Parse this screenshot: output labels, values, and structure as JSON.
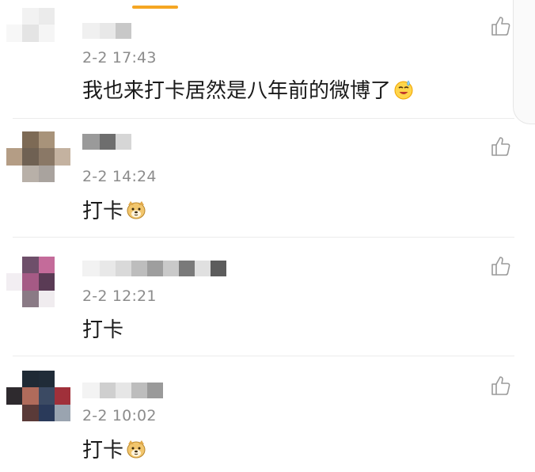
{
  "comments": [
    {
      "timestamp": "2-2 17:43",
      "text": "我也来打卡居然是八年前的微博了",
      "emoji": "sweat-smile-emoji",
      "avatar_colors": [
        "#ffffff",
        "#f2f2f2",
        "#ebebeb",
        "#ffffff",
        "#f7f7f7",
        "#e4e4e4",
        "#f5f5f5",
        "#ffffff",
        "#ffffff",
        "#ffffff",
        "#ffffff",
        "#ffffff"
      ],
      "name_blocks": [
        "#f0f0f0",
        "#e8e8e8",
        "#c8c8c8"
      ]
    },
    {
      "timestamp": "2-2 14:24",
      "text": "打卡",
      "emoji": "doge-emoji",
      "avatar_colors": [
        "#ffffff",
        "#7d6a55",
        "#a8937a",
        "#ffffff",
        "#b49d85",
        "#6f6153",
        "#8a7866",
        "#c4b2a0",
        "#ffffff",
        "#b8b0a8",
        "#a9a39e",
        "#ffffff"
      ],
      "name_blocks": [
        "#9a9a9a",
        "#6e6e6e",
        "#d6d6d6"
      ]
    },
    {
      "timestamp": "2-2 12:21",
      "text": "打卡",
      "emoji": "",
      "avatar_colors": [
        "#ffffff",
        "#6e4f6a",
        "#c46b9a",
        "#ffffff",
        "#f2eef2",
        "#a55a85",
        "#5a3b55",
        "#ffffff",
        "#ffffff",
        "#8a7a85",
        "#f0ecef",
        "#ffffff"
      ],
      "name_blocks": [
        "#f2f2f2",
        "#e8e8e8",
        "#d9d9d9",
        "#bdbdbd",
        "#9e9e9e",
        "#c9c9c9",
        "#7a7a7a",
        "#e0e0e0",
        "#5c5c5c"
      ]
    },
    {
      "timestamp": "2-2 10:02",
      "text": "打卡",
      "emoji": "doge-emoji",
      "avatar_colors": [
        "#ffffff",
        "#1f2a35",
        "#202c38",
        "#ffffff",
        "#2e2a2e",
        "#b06b5b",
        "#3b4a63",
        "#a0303a",
        "#ffffff",
        "#5a3a38",
        "#2a3a5a",
        "#9aa4b0"
      ],
      "name_blocks": [
        "#f3f3f3",
        "#cfcfcf",
        "#e6e6e6",
        "#bdbdbd",
        "#9a9a9a"
      ]
    }
  ]
}
